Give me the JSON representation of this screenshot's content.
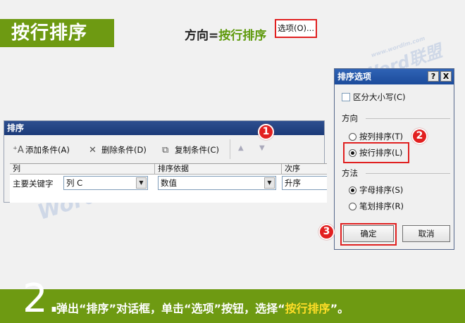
{
  "header": {
    "title": "按行排序",
    "subtitle_prefix": "方向=",
    "subtitle_highlight": "按行排序"
  },
  "watermark": {
    "brand": "Word",
    "brand_cn": "联盟",
    "url": "www.wordlm.com"
  },
  "sort_dialog": {
    "title": "排序",
    "toolbar": {
      "add_label": "添加条件(A)",
      "delete_label": "删除条件(D)",
      "copy_label": "复制条件(C)",
      "options_label": "选项(O)..."
    },
    "columns": [
      "列",
      "排序依据",
      "次序"
    ],
    "row": {
      "label": "主要关键字",
      "column_value": "列 C",
      "basis_value": "数值",
      "order_value": "升序"
    }
  },
  "options_dialog": {
    "title": "排序选项",
    "help": "?",
    "close": "X",
    "case_label": "区分大小写(C)",
    "direction_label": "方向",
    "by_column_label": "按列排序(T)",
    "by_row_label": "按行排序(L)",
    "method_label": "方法",
    "alpha_label": "字母排序(S)",
    "stroke_label": "笔划排序(R)",
    "ok_label": "确定",
    "cancel_label": "取消",
    "direction_selected": "按行排序(L)",
    "method_selected": "字母排序(S)"
  },
  "badges": [
    "1",
    "2",
    "3"
  ],
  "footer": {
    "step": "2.",
    "part1": "弹出“排序”对话框，单击“选项”按钮，选择“",
    "highlight": "按行排序",
    "part2": "”。"
  },
  "colors": {
    "brand_green": "#6e9a12",
    "highlight_red": "#e02020",
    "highlight_yellow": "#ffde27"
  }
}
